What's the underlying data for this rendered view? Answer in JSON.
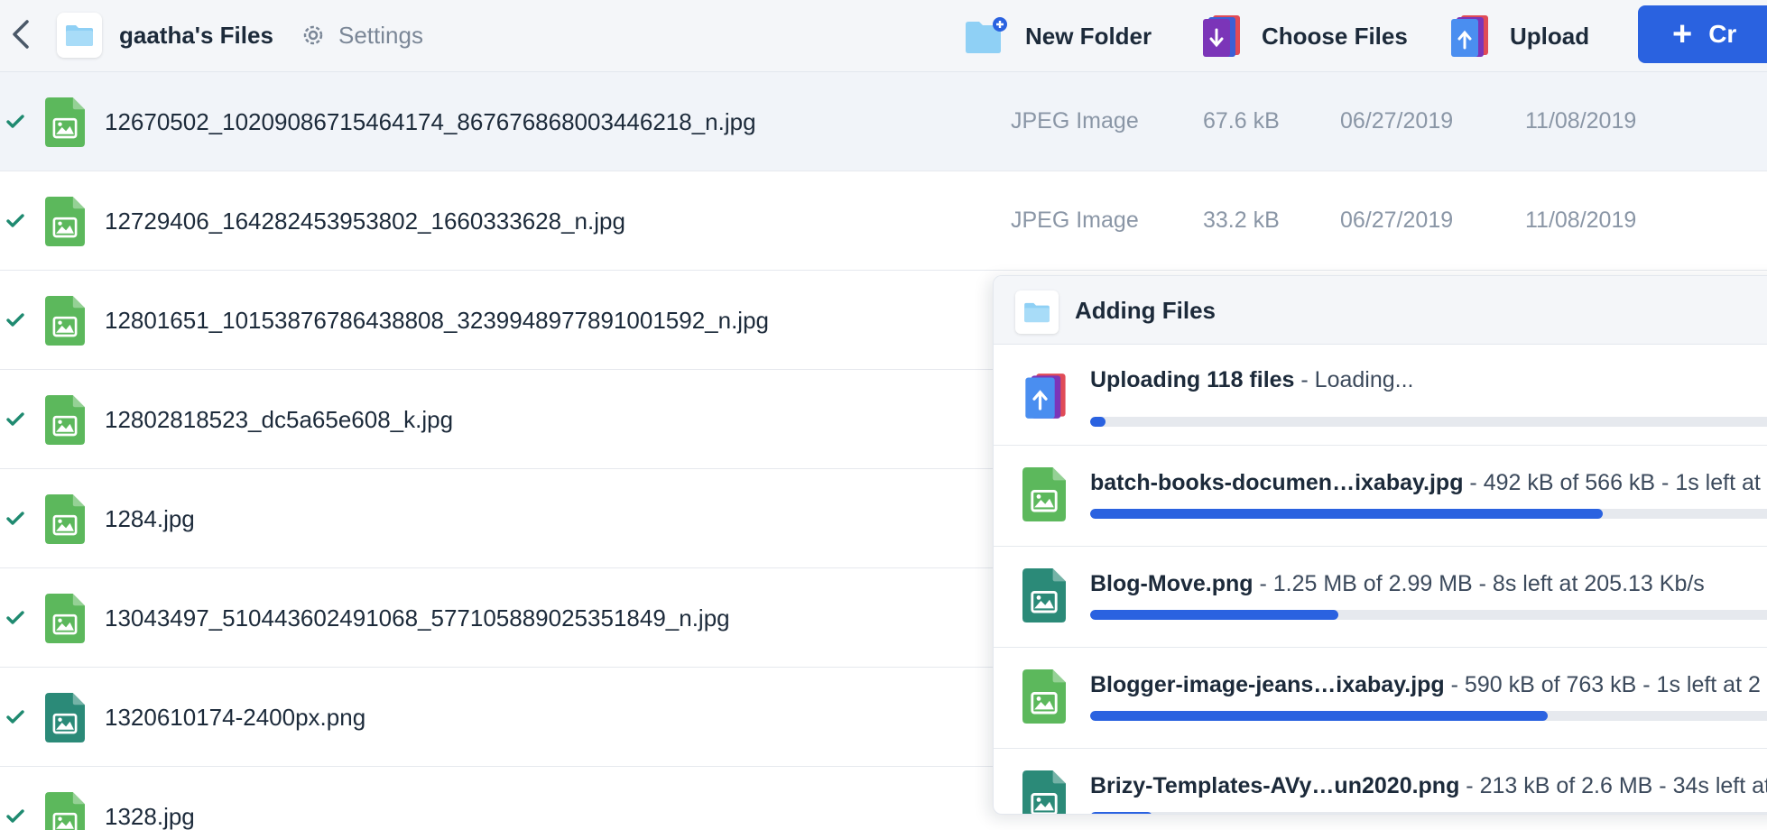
{
  "toolbar": {
    "title": "gaatha's Files",
    "settings_label": "Settings",
    "new_folder_label": "New Folder",
    "choose_files_label": "Choose Files",
    "upload_label": "Upload",
    "create_label": "Cr",
    "accent_color": "#2a62e0"
  },
  "files": [
    {
      "name": "12670502_10209086715464174_867676868003446218_n.jpg",
      "type": "JPEG Image",
      "size": "67.6 kB",
      "created": "06/27/2019",
      "modified": "11/08/2019",
      "kind": "jpg",
      "selected": true
    },
    {
      "name": "12729406_164282453953802_1660333628_n.jpg",
      "type": "JPEG Image",
      "size": "33.2 kB",
      "created": "06/27/2019",
      "modified": "11/08/2019",
      "kind": "jpg",
      "selected": false
    },
    {
      "name": "12801651_10153876786438808_3239948977891001592_n.jpg",
      "type": "",
      "size": "",
      "created": "",
      "modified": "",
      "kind": "jpg",
      "selected": false
    },
    {
      "name": "12802818523_dc5a65e608_k.jpg",
      "type": "",
      "size": "",
      "created": "",
      "modified": "",
      "kind": "jpg",
      "selected": false
    },
    {
      "name": "1284.jpg",
      "type": "",
      "size": "",
      "created": "",
      "modified": "",
      "kind": "jpg",
      "selected": false
    },
    {
      "name": "13043497_510443602491068_577105889025351849_n.jpg",
      "type": "",
      "size": "",
      "created": "",
      "modified": "",
      "kind": "jpg",
      "selected": false
    },
    {
      "name": "1320610174-2400px.png",
      "type": "",
      "size": "",
      "created": "",
      "modified": "",
      "kind": "png",
      "selected": false
    },
    {
      "name": "1328.jpg",
      "type": "",
      "size": "",
      "created": "",
      "modified": "",
      "kind": "jpg",
      "selected": false
    }
  ],
  "upload_panel": {
    "title": "Adding Files",
    "summary": {
      "bold": "Uploading 118 files",
      "rest": " - Loading...",
      "progress": 0.02
    },
    "items": [
      {
        "bold": "batch-books-documen…ixabay.jpg",
        "rest": " - 492 kB of 566 kB - 1s left at",
        "progress": 0.66,
        "kind": "jpg"
      },
      {
        "bold": "Blog-Move.png",
        "rest": " - 1.25 MB of 2.99 MB - 8s left at 205.13 Kb/s",
        "progress": 0.32,
        "kind": "png"
      },
      {
        "bold": "Blogger-image-jeans…ixabay.jpg",
        "rest": " - 590 kB of 763 kB - 1s left at 2",
        "progress": 0.59,
        "kind": "jpg"
      },
      {
        "bold": "Brizy-Templates-AVy…un2020.png",
        "rest": " - 213 kB of 2.6 MB - 34s left at",
        "progress": 0.08,
        "kind": "png"
      }
    ]
  }
}
